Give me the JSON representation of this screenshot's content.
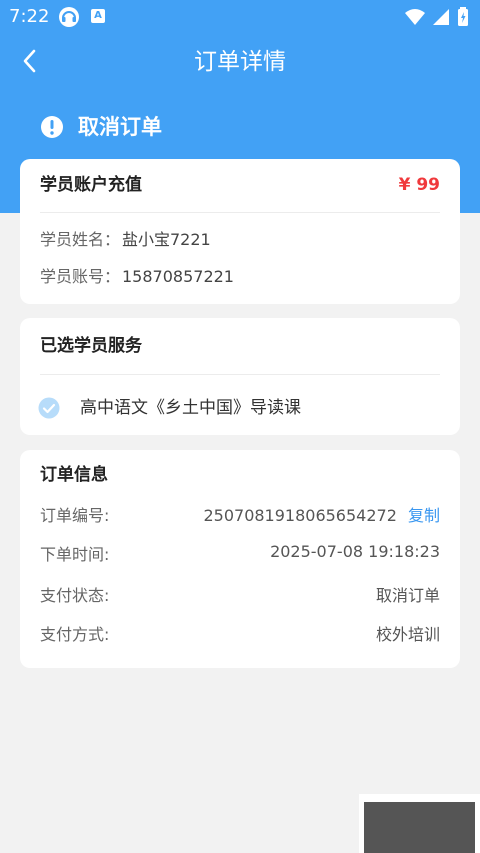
{
  "status_bar": {
    "time": "7:22",
    "icons": [
      "headset-icon",
      "a-icon",
      "wifi-icon",
      "signal-icon",
      "battery-icon"
    ],
    "a_glyph": "A"
  },
  "nav": {
    "title": "订单详情",
    "back_icon": "chevron-left-icon"
  },
  "banner": {
    "status_text": "取消订单",
    "icon": "exclamation-circle-icon"
  },
  "account_card": {
    "title": "学员账户充值",
    "price": "¥ 99",
    "name_label": "学员姓名：",
    "name_value": "盐小宝7221",
    "account_label": "学员账号：",
    "account_value": "15870857221"
  },
  "service_card": {
    "title": "已选学员服务",
    "item": "高中语文《乡土中国》导读课",
    "check_icon": "check-circle-icon"
  },
  "order_card": {
    "title": "订单信息",
    "rows": [
      {
        "label": "订单编号:",
        "value": "2507081918065654272",
        "action": "复制"
      },
      {
        "label": "下单时间:",
        "value": "2025-07-08 19:18:23"
      },
      {
        "label": "支付状态:",
        "value": "取消订单"
      },
      {
        "label": "支付方式:",
        "value": "校外培训"
      }
    ]
  },
  "colors": {
    "primary": "#42a1f5",
    "price": "#f0393c",
    "link": "#3a97f0",
    "background": "#f2f2f2"
  }
}
